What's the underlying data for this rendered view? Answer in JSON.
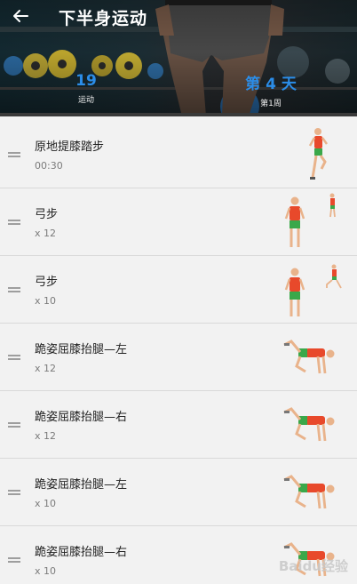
{
  "header": {
    "title": "下半身运动",
    "stats": [
      {
        "value": "19",
        "label": "运动"
      },
      {
        "value": "第 4 天",
        "label": "第1周"
      }
    ]
  },
  "exercises": [
    {
      "name": "原地提膝踏步",
      "detail": "00:30"
    },
    {
      "name": "弓步",
      "detail": "x 12"
    },
    {
      "name": "弓步",
      "detail": "x 10"
    },
    {
      "name": "跪姿屈膝抬腿—左",
      "detail": "x 12"
    },
    {
      "name": "跪姿屈膝抬腿—右",
      "detail": "x 12"
    },
    {
      "name": "跪姿屈膝抬腿—左",
      "detail": "x 10"
    },
    {
      "name": "跪姿屈膝抬腿—右",
      "detail": "x 10"
    }
  ],
  "watermark": "Baidu经验",
  "colors": {
    "accent": "#2b8de8",
    "shirt": "#e8492b",
    "shorts": "#3aa84a",
    "skin": "#e9b38b"
  }
}
